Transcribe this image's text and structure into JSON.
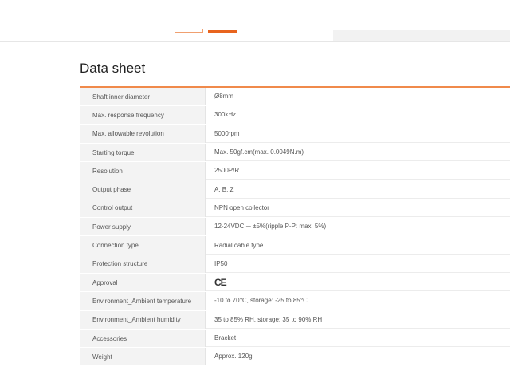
{
  "heading": "Data sheet",
  "specs": [
    {
      "label": "Shaft inner diameter",
      "value": "Ø8mm"
    },
    {
      "label": "Max. response frequency",
      "value": "300kHz"
    },
    {
      "label": "Max. allowable revolution",
      "value": "5000rpm"
    },
    {
      "label": "Starting torque",
      "value": "Max. 50gf.cm(max. 0.0049N.m)"
    },
    {
      "label": "Resolution",
      "value": "2500P/R"
    },
    {
      "label": "Output phase",
      "value": "A, B, Z"
    },
    {
      "label": "Control output",
      "value": "NPN open collector"
    },
    {
      "label": "Power supply",
      "value": "12-24VDC ⎓ ±5%(ripple P-P: max. 5%)"
    },
    {
      "label": "Connection type",
      "value": "Radial cable type"
    },
    {
      "label": "Protection structure",
      "value": "IP50"
    },
    {
      "label": "Approval",
      "value": "CE"
    },
    {
      "label": "Environment_Ambient temperature",
      "value": "-10 to 70℃, storage: -25 to 85℃"
    },
    {
      "label": "Environment_Ambient humidity",
      "value": "35 to 85% RH, storage: 35 to 90% RH"
    },
    {
      "label": "Accessories",
      "value": "Bracket"
    },
    {
      "label": "Weight",
      "value": "Approx. 120g"
    }
  ],
  "colors": {
    "accent": "#e8641e",
    "row_label_bg": "#f3f3f3"
  },
  "icons": {
    "approval": "ce-mark-icon"
  }
}
